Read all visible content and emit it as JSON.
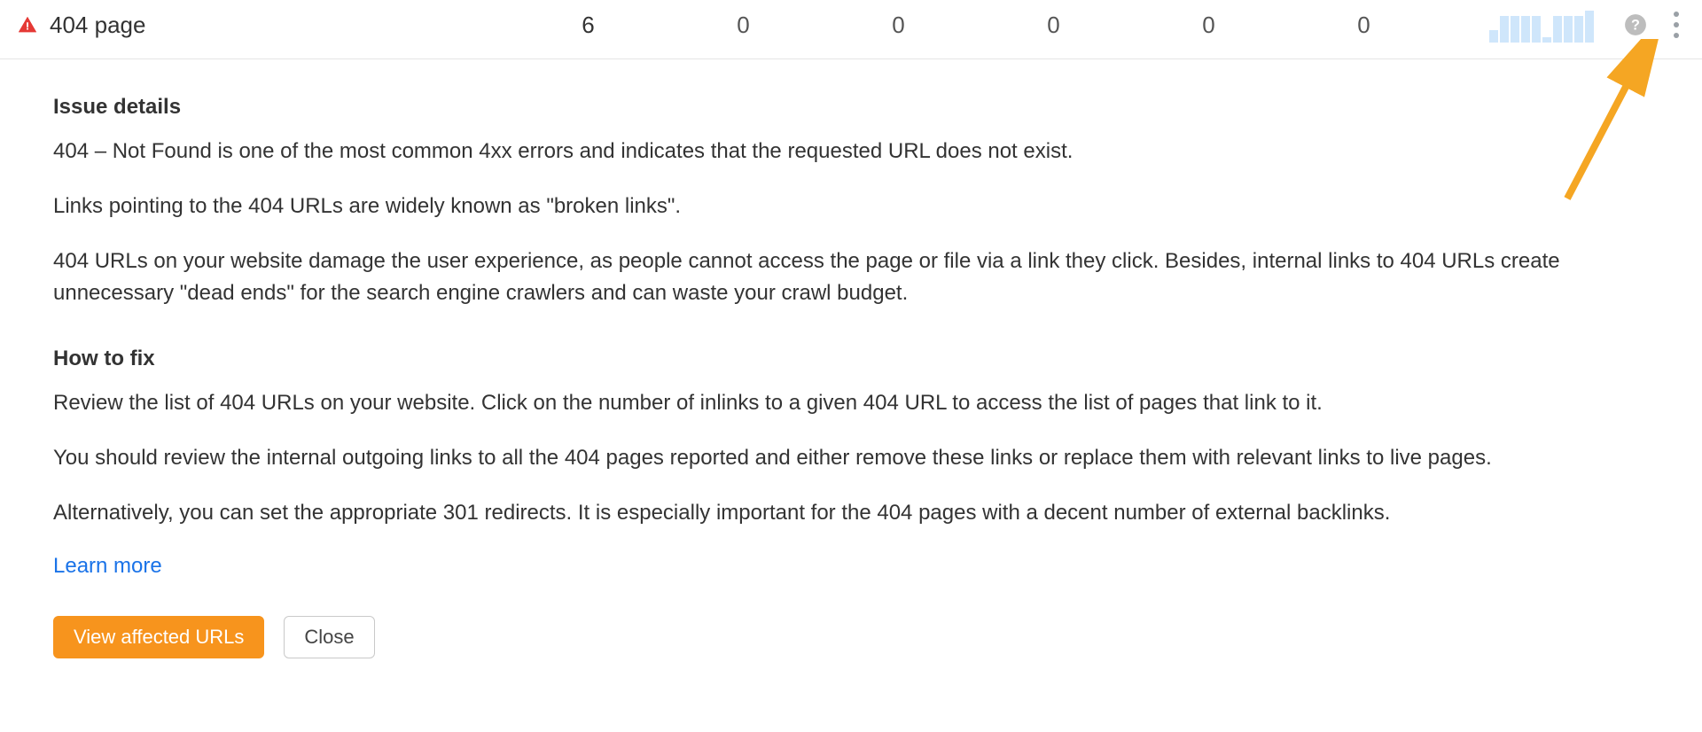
{
  "row": {
    "title": "404 page",
    "counts": [
      "6",
      "0",
      "0",
      "0",
      "0",
      "0"
    ],
    "sparkline": [
      10,
      22,
      22,
      22,
      22,
      4,
      22,
      22,
      22,
      26
    ]
  },
  "details": {
    "heading1": "Issue details",
    "p1": "404 – Not Found is one of the most common 4xx errors and indicates that the requested URL does not exist.",
    "p2": "Links pointing to the 404 URLs are widely known as \"broken links\".",
    "p3": "404 URLs on your website damage the user experience, as people cannot access the page or file via a link they click. Besides, internal links to 404 URLs create unnecessary \"dead ends\" for the search engine crawlers and can waste your crawl budget.",
    "heading2": "How to fix",
    "p4": "Review the list of 404 URLs on your website. Click on the number of inlinks to a given 404 URL to access the list of pages that link to it.",
    "p5": "You should review the internal outgoing links to all the 404 pages reported and either remove these links or replace them with relevant links to live pages.",
    "p6": "Alternatively, you can set the appropriate 301 redirects. It is especially important for the 404 pages with a decent number of external backlinks.",
    "learn_more": "Learn more"
  },
  "buttons": {
    "primary": "View affected URLs",
    "secondary": "Close"
  },
  "chart_data": {
    "type": "bar",
    "categories": [
      "1",
      "2",
      "3",
      "4",
      "5",
      "6",
      "7",
      "8",
      "9",
      "10"
    ],
    "values": [
      10,
      22,
      22,
      22,
      22,
      4,
      22,
      22,
      22,
      26
    ],
    "title": "",
    "xlabel": "",
    "ylabel": "",
    "ylim": [
      0,
      30
    ]
  }
}
